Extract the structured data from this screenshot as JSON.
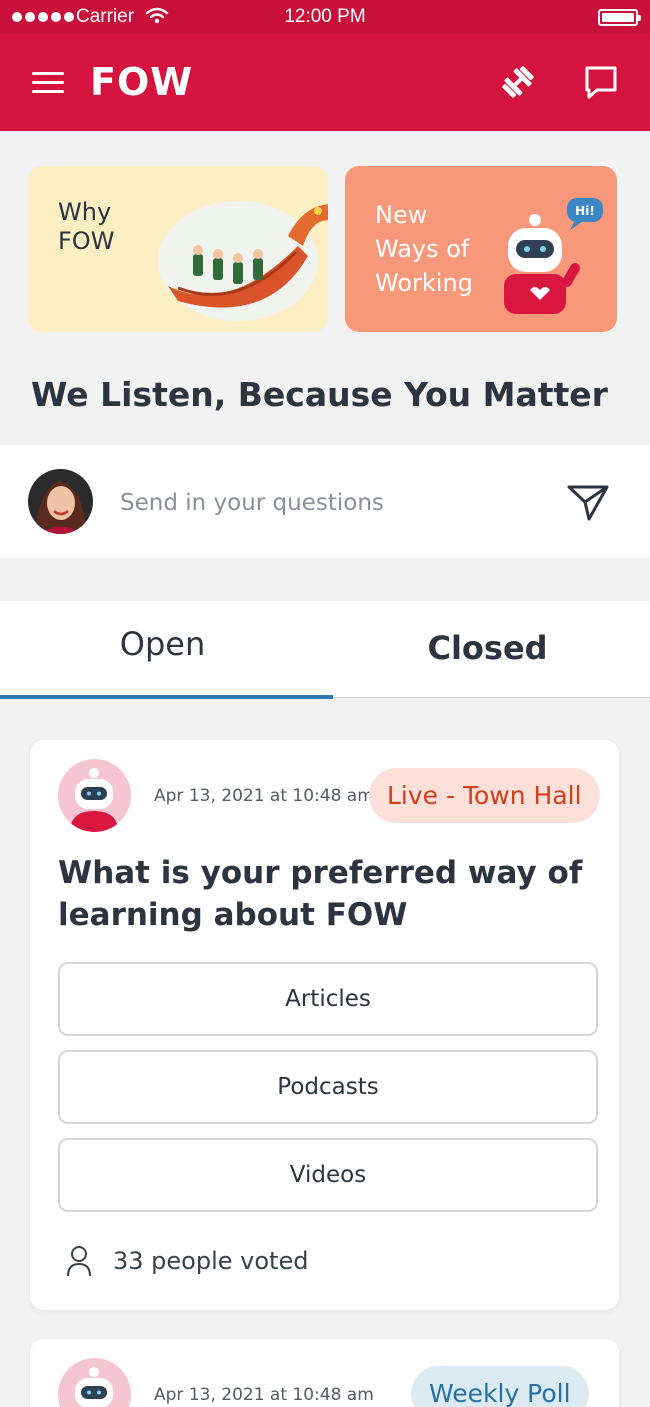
{
  "status_bar": {
    "carrier": "Carrier",
    "time": "12:00 PM"
  },
  "app_bar": {
    "title": "FOW"
  },
  "banners": [
    {
      "label": "Why\nFOW"
    },
    {
      "label": "New\nWays of\nWorking",
      "speech": "Hi!"
    }
  ],
  "headline": "We Listen, Because You Matter",
  "ask": {
    "placeholder": "Send in your questions"
  },
  "tabs": {
    "open": "Open",
    "closed": "Closed"
  },
  "polls": [
    {
      "date": "Apr 13, 2021 at 10:48 am",
      "badge": "Live - Town Hall",
      "question": "What is your preferred way of learning about FOW",
      "options": [
        "Articles",
        "Podcasts",
        "Videos"
      ],
      "votes": "33 people voted"
    },
    {
      "date": "Apr 13, 2021 at 10:48 am",
      "badge": "Weekly Poll"
    }
  ],
  "colors": {
    "brand": "#d4143f",
    "tab_indicator": "#2d7bb0",
    "live_badge": "#d0401c",
    "weekly_badge": "#2570a6"
  }
}
